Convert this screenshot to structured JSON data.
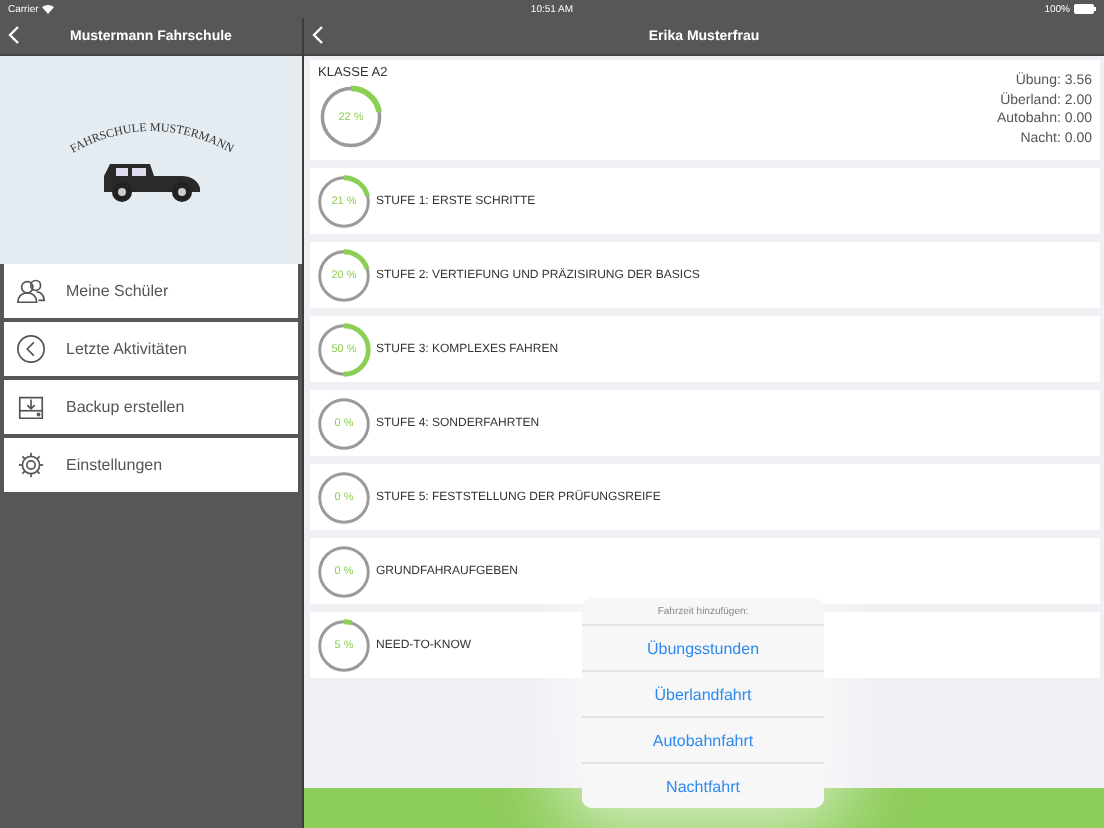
{
  "status_bar": {
    "carrier": "Carrier",
    "time": "10:51 AM",
    "battery": "100%"
  },
  "sidebar": {
    "title": "Mustermann Fahrschule",
    "logo_text": "FAHRSCHULE MUSTERMANN",
    "items": [
      {
        "label": "Meine Schüler",
        "kind": "users"
      },
      {
        "label": "Letzte Aktivitäten",
        "kind": "history"
      },
      {
        "label": "Backup erstellen",
        "kind": "backup"
      },
      {
        "label": "Einstellungen",
        "kind": "settings"
      }
    ]
  },
  "detail": {
    "title": "Erika Musterfrau",
    "summary": {
      "label": "KLASSE A2",
      "percent": "22 %",
      "level": 0.22,
      "stats": [
        "Übung: 3.56",
        "Überland: 2.00",
        "Autobahn: 0.00",
        "Nacht: 0.00"
      ]
    },
    "stages": [
      {
        "label": "STUFE 1: ERSTE SCHRITTE",
        "percent": "21 %",
        "level": 0.21
      },
      {
        "label": "STUFE 2: VERTIEFUNG UND PRÄZISIRUNG DER BASICS",
        "percent": "20 %",
        "level": 0.2
      },
      {
        "label": "STUFE 3: KOMPLEXES FAHREN",
        "percent": "50 %",
        "level": 0.5
      },
      {
        "label": "STUFE 4: SONDERFAHRTEN",
        "percent": "0 %",
        "level": 0
      },
      {
        "label": "STUFE 5: FESTSTELLUNG DER PRÜFUNGSREIFE",
        "percent": "0 %",
        "level": 0
      },
      {
        "label": "GRUNDFAHRAUFGEBEN",
        "percent": "0 %",
        "level": 0
      },
      {
        "label": "NEED-TO-KNOW",
        "percent": "5 %",
        "level": 0.05
      }
    ]
  },
  "popover": {
    "title": "Fahrzeit hinzufügen:",
    "options": [
      "Übungsstunden",
      "Überlandfahrt",
      "Autobahnfahrt",
      "Nachtfahrt"
    ]
  }
}
